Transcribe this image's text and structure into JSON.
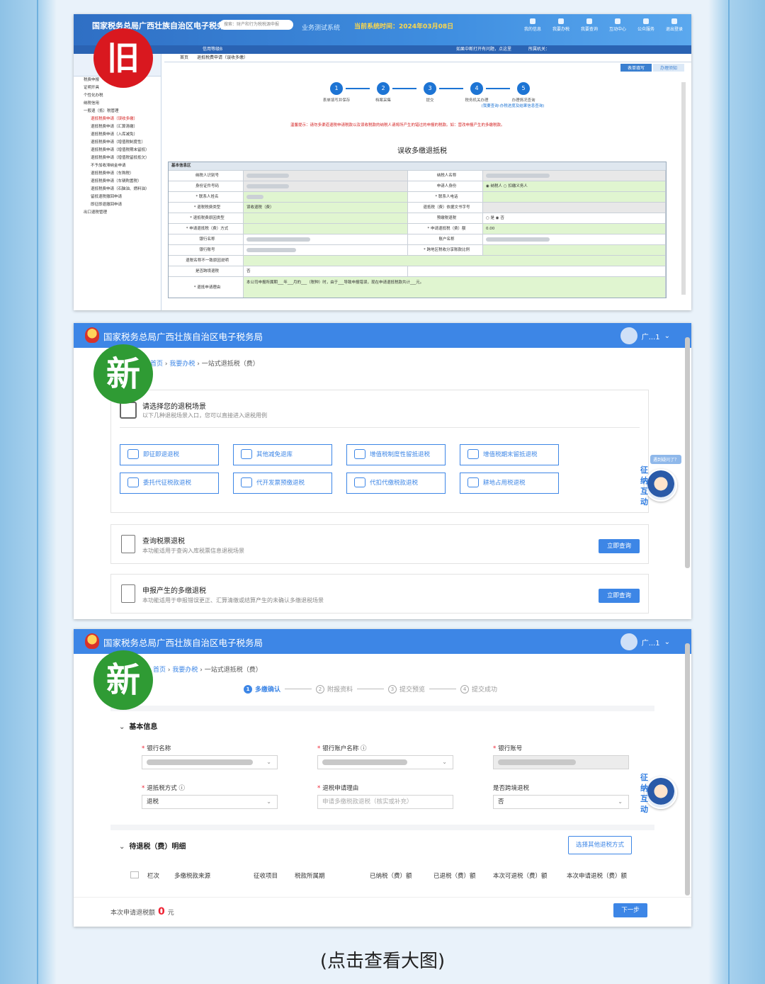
{
  "badges": {
    "old": "旧",
    "new": "新"
  },
  "caption": "(点击查看大图)",
  "old": {
    "title": "国家税务总局广西壮族自治区电子税务局",
    "search_placeholder": "搜索：财产和行为税税源申报",
    "biz_system": "业务测试系统",
    "system_time": "当前系统时间：2024年03月08日",
    "nav": [
      "我的信息",
      "我要办税",
      "我要查询",
      "互动中心",
      "公众服务",
      "退出登录"
    ],
    "sub_left": "信用等级B",
    "sub_right": "如果中断打开有问题，点这里",
    "sub_right2": "所属机关：",
    "tabs": [
      "首页",
      "退抵税费申请（误收多缴）"
    ],
    "tool_buttons": [
      "表单填写",
      "办理须知"
    ],
    "sidebar": [
      "税费申报",
      "证明开具",
      "个性化办税",
      "纳税信用",
      "一般退（抵）税管理",
      "退抵税费申请（误收多缴）",
      "退抵税费申请（汇算清缴）",
      "退抵税费申请（入库减免）",
      "退抵税费申请（增值税制度性）",
      "退抵税费申请（增值税期末留抵）",
      "退抵税费申请（增值税留抵抵欠）",
      "不予加收滞纳金申请",
      "退抵税费申请（车购税）",
      "退抵税费申请（车辆购置税）",
      "退抵税费申请（石脑油、燃料油）",
      "留抵退税撤回申请",
      "即征即退撤回申请",
      "出口退税管理"
    ],
    "steps": [
      {
        "n": "1",
        "label": "表单填写并保存"
      },
      {
        "n": "2",
        "label": "档案采集"
      },
      {
        "n": "3",
        "label": "提交"
      },
      {
        "n": "4",
        "label": "税务机关办理"
      },
      {
        "n": "5",
        "label": "办理情况查询"
      }
    ],
    "steps_note": "(我要查询-办税进度及结果信息查询)",
    "warning": "温馨提示：请勿多渠道退税申请税款以及误收税款的纳税人请将所产生的错过的申报的税款。如：营改申报产生的多缴税款。",
    "form_title": "误收多缴退抵税",
    "section": "基本信息区",
    "fields": [
      [
        "纳税人识别号",
        "",
        "纳税人名称",
        ""
      ],
      [
        "身份证件号码",
        "",
        "申请人身份",
        "◉ 纳税人  ○ 扣缴义务人"
      ],
      [
        "* 联系人姓名",
        "",
        "* 联系人电话",
        ""
      ],
      [
        "* 退税税费类型",
        "误收退税（费）",
        "退抵税（费）依据文书字号",
        ""
      ],
      [
        "* 退抵税费原因类型",
        "",
        "预缴税退税",
        "○ 是  ◉ 否"
      ],
      [
        "* 申请退抵税（费）方式",
        "",
        "* 申请退抵税（费）额",
        "0.00"
      ],
      [
        "银行名称",
        "",
        "账户名称",
        ""
      ],
      [
        "银行账号",
        "",
        "* 跨地区税收分享账款比例",
        ""
      ],
      [
        "退税名称不一致原因说明",
        "",
        "",
        ""
      ],
      [
        "是否跨境退税",
        "否",
        "",
        ""
      ]
    ],
    "reason_label": "* 退抵申请理由",
    "reason_text": "本公司申报所属期___年___月的___（税种）时，由于___导致申报错误，现在申请退抵税款共计___元。"
  },
  "p2": {
    "title": "国家税务总局广西壮族自治区电子税务局",
    "user": "广...1",
    "breadcrumb": [
      "首页",
      "我要办税",
      "一站式退抵税（费）"
    ],
    "choose_title": "请选择您的退税场景",
    "choose_sub": "以下几种退税场景入口，您可以直接进入退税用例",
    "scenes": [
      "即征即退退税",
      "其他减免退库",
      "增值税制度性留抵退税",
      "增值税期末留抵退税",
      "委托代征税款退税",
      "代开发票预缴退税",
      "代扣代缴税款退税",
      "耕地占用税退税"
    ],
    "opt1_title": "查询税票退税",
    "opt1_sub": "本功能适用于查询入库税票信息退税场景",
    "opt2_title": "申报产生的多缴退税",
    "opt2_sub": "本功能适用于申报错误更正、汇算清缴或结算产生的未确认多缴退税场景",
    "go": "立即查询",
    "helper_tip": "遇到疑问了？",
    "helper": [
      "征",
      "纳",
      "互",
      "动"
    ]
  },
  "p3": {
    "title": "国家税务总局广西壮族自治区电子税务局",
    "user": "广...1",
    "breadcrumb": [
      "首页",
      "我要办税",
      "一站式退抵税（费）"
    ],
    "wizard": [
      {
        "n": "1",
        "label": "多缴确认"
      },
      {
        "n": "2",
        "label": "附报资料"
      },
      {
        "n": "3",
        "label": "提交预览"
      },
      {
        "n": "4",
        "label": "提交成功"
      }
    ],
    "basic_title": "基本信息",
    "bank_name_label": "银行名称",
    "bank_account_name_label": "银行账户名称",
    "bank_account_label": "银行账号",
    "refund_mode_label": "退抵税方式",
    "refund_mode_value": "退税",
    "reason_label": "退税申请理由",
    "reason_placeholder": "申请多缴税款退税（核实或补充）",
    "cross_label": "是否跨境退税",
    "cross_value": "否",
    "detail_title": "待退税（费）明细",
    "other_btn": "选择其他退税方式",
    "table_headers": [
      "栏次",
      "多缴税款来源",
      "征收项目",
      "税款所属期",
      "已纳税（费）额",
      "已退税（费）额",
      "本次可退税（费）额",
      "本次申请退税（费）额"
    ],
    "total_label": "本次申请退税额",
    "total_value": "0",
    "total_unit": "元",
    "next": "下一步"
  }
}
